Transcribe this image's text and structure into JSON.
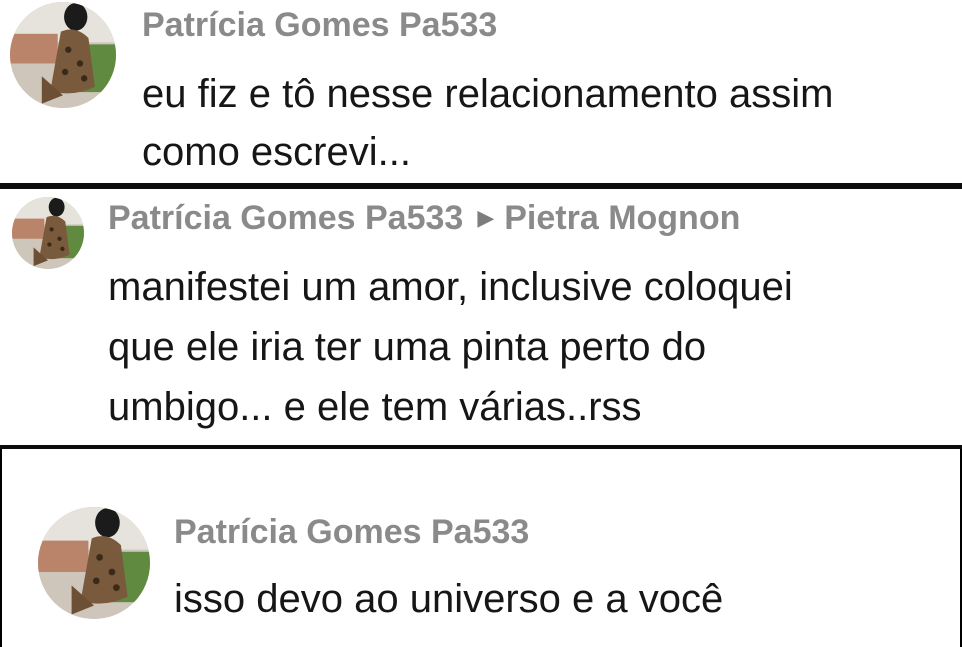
{
  "comments": [
    {
      "author": "Patrícia Gomes Pa533",
      "lines": [
        "eu fiz e tô nesse relacionamento assim",
        "como escrevi..."
      ]
    },
    {
      "author": "Patrícia Gomes Pa533",
      "arrow": "▶",
      "reply_to": "Pietra Mognon",
      "lines": [
        "manifestei um amor, inclusive coloquei",
        "que ele iria ter uma pinta perto do",
        "umbigo... e ele tem várias..rss"
      ]
    },
    {
      "author": "Patrícia Gomes Pa533",
      "lines": [
        "isso devo ao universo e a você"
      ]
    }
  ],
  "colors": {
    "username": "#8a8a8a",
    "message": "#161616",
    "divider": "#0c0c0c"
  }
}
